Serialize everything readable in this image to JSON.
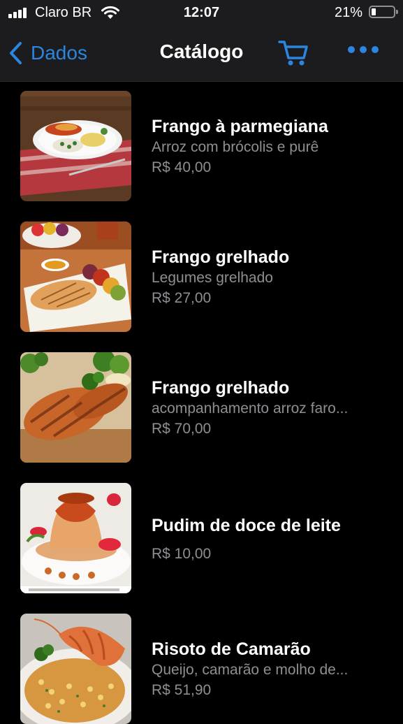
{
  "status_bar": {
    "carrier": "Claro BR",
    "time": "12:07",
    "battery_percent": "21%"
  },
  "nav": {
    "back_label": "Dados",
    "title": "Catálogo",
    "cart_icon": "cart-icon",
    "more_icon": "more-icon"
  },
  "colors": {
    "accent": "#2a86e0",
    "background": "#000000",
    "bar": "#1c1c1e",
    "secondary_text": "#8e8e93"
  },
  "items": [
    {
      "name": "Frango à parmegiana",
      "description": "Arroz com brócolis e purê",
      "price": "R$ 40,00"
    },
    {
      "name": "Frango grelhado",
      "description": "Legumes grelhado",
      "price": "R$ 27,00"
    },
    {
      "name": "Frango grelhado",
      "description": "acompanhamento arroz faro...",
      "price": "R$ 70,00"
    },
    {
      "name": "Pudim de doce de leite",
      "description": "",
      "price": "R$ 10,00"
    },
    {
      "name": "Risoto de Camarão",
      "description": "Queijo, camarão e molho de...",
      "price": "R$ 51,90"
    }
  ]
}
